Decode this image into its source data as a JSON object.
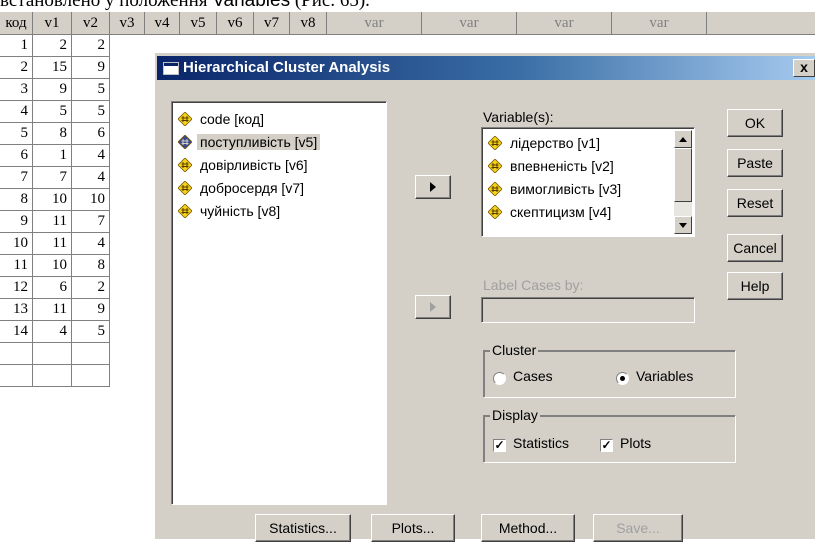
{
  "caption": {
    "text": "встановлено у положення ",
    "highlight": "Variables",
    "suffix": " (Рис. 65)."
  },
  "grid": {
    "headers": [
      "код",
      "v1",
      "v2",
      "v3",
      "v4",
      "v5",
      "v6",
      "v7",
      "v8",
      "var",
      "var",
      "var",
      "var"
    ],
    "rows": [
      [
        "1",
        "2",
        "2"
      ],
      [
        "2",
        "15",
        "9"
      ],
      [
        "3",
        "9",
        "5"
      ],
      [
        "4",
        "5",
        "5"
      ],
      [
        "5",
        "8",
        "6"
      ],
      [
        "6",
        "1",
        "4"
      ],
      [
        "7",
        "7",
        "4"
      ],
      [
        "8",
        "10",
        "10"
      ],
      [
        "9",
        "11",
        "7"
      ],
      [
        "10",
        "11",
        "4"
      ],
      [
        "11",
        "10",
        "8"
      ],
      [
        "12",
        "6",
        "2"
      ],
      [
        "13",
        "11",
        "9"
      ],
      [
        "14",
        "4",
        "5"
      ],
      [
        "",
        "",
        ""
      ],
      [
        "",
        "",
        ""
      ]
    ]
  },
  "dialog": {
    "title": "Hierarchical Cluster Analysis",
    "close_label": "x",
    "source_list": [
      {
        "label": "code [код]",
        "icon": "scale-variable-icon"
      },
      {
        "label": "поступливість [v5]",
        "icon": "selected-variable-icon",
        "selected": true
      },
      {
        "label": "довірливість [v6]",
        "icon": "scale-variable-icon"
      },
      {
        "label": "добросердя [v7]",
        "icon": "scale-variable-icon"
      },
      {
        "label": "чуйність [v8]",
        "icon": "scale-variable-icon"
      }
    ],
    "variables_label": "Variable(s):",
    "variables_list": [
      "лідерство [v1]",
      "впевненість [v2]",
      "вимогливість [v3]",
      "скептицизм [v4]"
    ],
    "label_cases_label": "Label Cases by:",
    "label_cases_value": "",
    "cluster": {
      "title": "Cluster",
      "options": [
        "Cases",
        "Variables"
      ],
      "selected": "Variables"
    },
    "display": {
      "title": "Display",
      "options": [
        {
          "label": "Statistics",
          "checked": true
        },
        {
          "label": "Plots",
          "checked": true
        }
      ]
    },
    "side_buttons": [
      "OK",
      "Paste",
      "Reset",
      "Cancel",
      "Help"
    ],
    "bottom_buttons": [
      {
        "label": "Statistics...",
        "enabled": true
      },
      {
        "label": "Plots...",
        "enabled": true
      },
      {
        "label": "Method...",
        "enabled": true
      },
      {
        "label": "Save...",
        "enabled": false
      }
    ],
    "colors": {
      "title_start": "#0a246a",
      "title_end": "#a6caf0",
      "face": "#d4d0c8",
      "icon_yellow": "#f2d21a"
    }
  }
}
